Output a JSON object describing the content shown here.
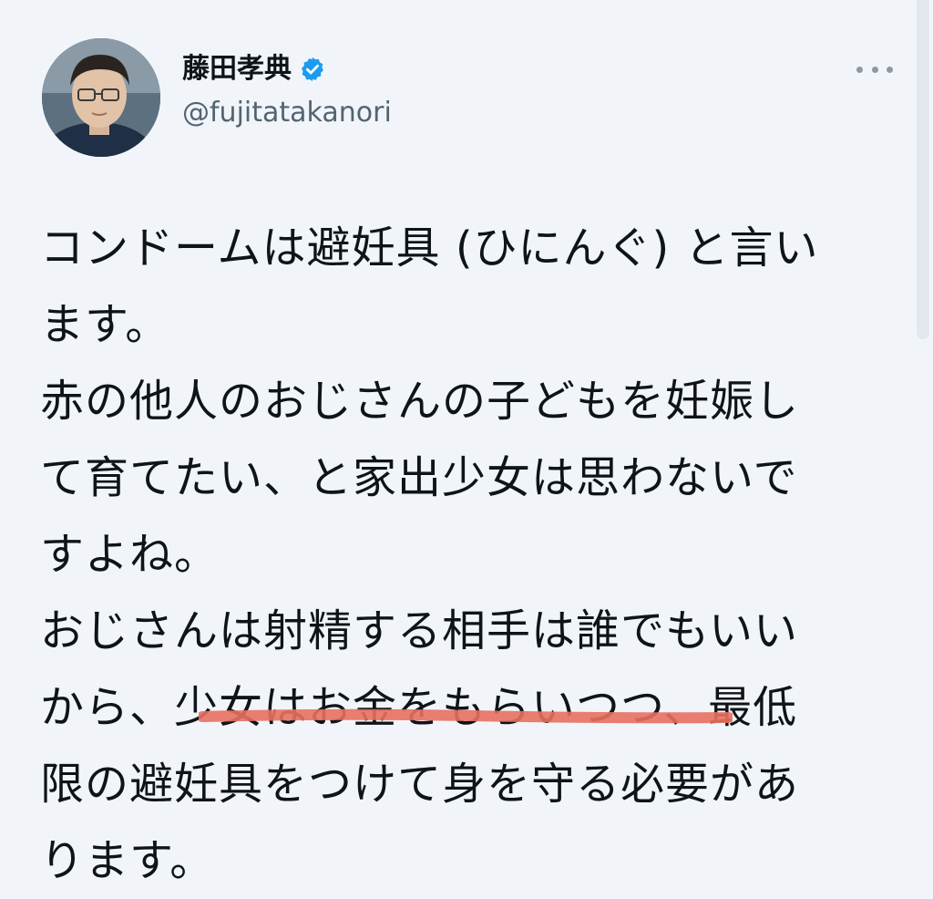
{
  "author": {
    "display_name": "藤田孝典",
    "handle": "@fujitatakanori",
    "verified": true,
    "avatar_icon": "avatar-photo"
  },
  "more_button": {
    "icon": "more-horizontal-icon"
  },
  "tweet": {
    "lines": [
      "コンドームは避妊具 (ひにんぐ) と言い",
      "ます。",
      "赤の他人のおじさんの子どもを妊娠し",
      "て育てたい、と家出少女は思わないで",
      "すよね。",
      "おじさんは射精する相手は誰でもいい",
      "から、少女はお金をもらいつつ、最低",
      "限の避妊具をつけて身を守る必要があ",
      "ります。"
    ]
  },
  "colors": {
    "background": "#f1f5fa",
    "text": "#0f1419",
    "handle": "#536471",
    "verified_badge": "#1d9bf0",
    "underline_annotation": "#e8705f"
  }
}
